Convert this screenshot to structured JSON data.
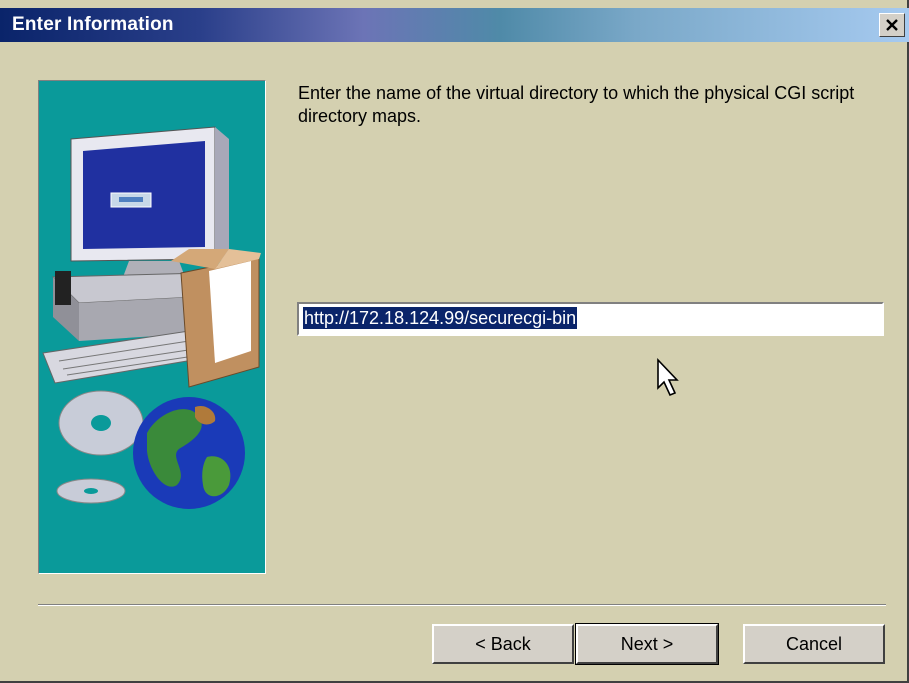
{
  "window": {
    "title": "Enter Information",
    "close_icon": "close-icon"
  },
  "content": {
    "prompt": "Enter the name of the virtual directory to which the physical CGI script directory maps.",
    "url_value": "http://172.18.124.99/securecgi-bin"
  },
  "buttons": {
    "back": "< Back",
    "next": "Next >",
    "cancel": "Cancel"
  },
  "colors": {
    "titlebar_start": "#0a246a",
    "dialog_bg": "#d4d0b0",
    "illustration_bg": "#0a9a9a",
    "selection": "#0a246a"
  }
}
